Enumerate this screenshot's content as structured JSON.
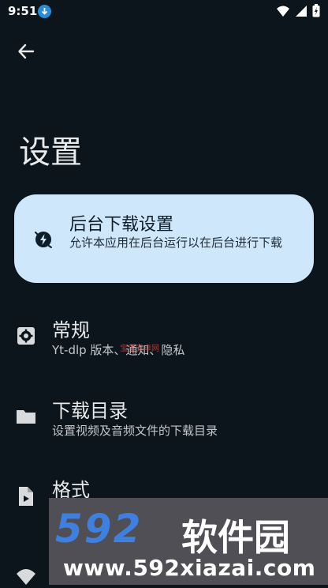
{
  "status_bar": {
    "time": "9:51",
    "icons": [
      "download-icon",
      "wifi-icon",
      "signal-icon",
      "battery-icon"
    ]
  },
  "header": {
    "back_icon": "back-arrow-icon",
    "title": "设置"
  },
  "background_card": {
    "icon": "bolt-icon",
    "title": "后台下载设置",
    "description": "允许本应用在后台运行以在后台进行下载",
    "bg_color": "#cfe7fa"
  },
  "settings_items": [
    {
      "icon": "gear-icon",
      "title": "常规",
      "description": "Yt-dlp 版本、通知、隐私"
    },
    {
      "icon": "folder-icon",
      "title": "下载目录",
      "description": "设置视频及音频文件的下载目录"
    },
    {
      "icon": "file-video-icon",
      "title": "格式",
      "description": ""
    }
  ],
  "watermark": {
    "small_text": "宝宝安卓网",
    "logo_number": "592",
    "logo_text": "软件园",
    "url": "www.592xiazai.com"
  }
}
